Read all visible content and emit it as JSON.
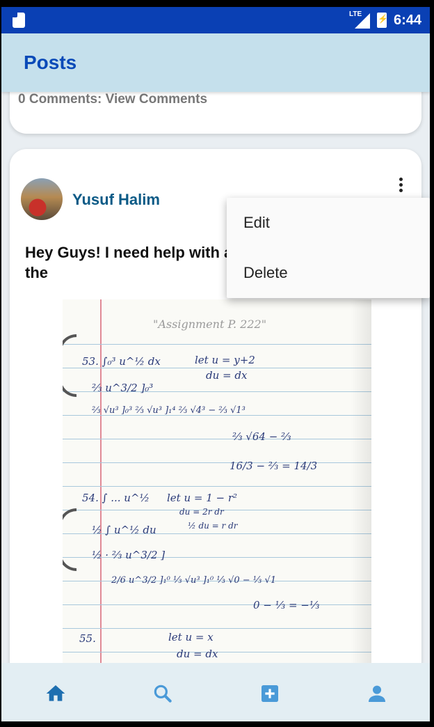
{
  "status_bar": {
    "network": "LTE",
    "time": "6:44"
  },
  "app_bar": {
    "title": "Posts"
  },
  "previous_post": {
    "comments_label": "0 Comments: View Comments"
  },
  "post": {
    "author": "Yusuf Halim",
    "text": "Hey Guys! I need help with assignment! It's #55 in the",
    "image": {
      "pencil_heading": "\"Assignment P. 222\"",
      "lines": [
        "53. ∫₀³ u^½ dx",
        "let u = y+2",
        "du = dx",
        "⅔ u^3/2 ]₀³",
        "⅔ √u³ ]₀³   ⅔ √u³ ]₁⁴   ⅔ √4³ − ⅔ √1³",
        "⅔ √64 − ⅔",
        "16/3 − ⅔ = 14/3",
        "54. ∫ ... u^½",
        "let u = 1 − r²",
        "du = 2r dr",
        "½ du = r dr",
        "½ ∫ u^½ du",
        "½ · ⅔ u^3/2 ]",
        "2/6 u^3/2 ]₁⁰   ⅓ √u³ ]₁⁰   ⅓ √0 − ⅓ √1",
        "0 − ⅓ = −⅓",
        "55.",
        "let u = x",
        "du = dx"
      ]
    }
  },
  "context_menu": {
    "items": [
      "Edit",
      "Delete"
    ]
  },
  "bottom_nav": {
    "items": [
      {
        "name": "home",
        "icon": "home-icon",
        "color": "#1e6fb0"
      },
      {
        "name": "search",
        "icon": "search-icon",
        "color": "#4a9ad8"
      },
      {
        "name": "add-post",
        "icon": "add-box-icon",
        "color": "#4a9ad8"
      },
      {
        "name": "profile",
        "icon": "person-icon",
        "color": "#4a9ad8"
      }
    ]
  },
  "colors": {
    "status_bar": "#0a40b4",
    "app_bar": "#c5e0ec",
    "title": "#0a4ab8",
    "author": "#0b5a86",
    "bottom_bar": "#e3eef3"
  }
}
